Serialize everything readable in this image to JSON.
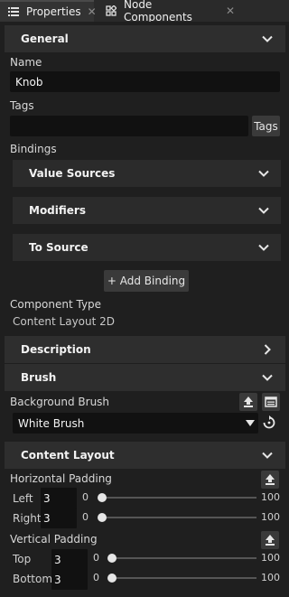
{
  "tabs": [
    {
      "label": "Properties",
      "icon": "list-icon",
      "close": "✕"
    },
    {
      "label": "Node Components",
      "icon": "node-components-icon",
      "close": "✕"
    }
  ],
  "general": {
    "title": "General",
    "name_label": "Name",
    "name_value": "Knob",
    "tags_label": "Tags",
    "tags_value": "",
    "tags_button": "Tags",
    "bindings_label": "Bindings",
    "bindings": [
      {
        "label": "Value Sources"
      },
      {
        "label": "Modifiers"
      },
      {
        "label": "To Source"
      }
    ],
    "add_binding": "+ Add Binding",
    "component_type_label": "Component Type",
    "component_type_value": "Content Layout 2D"
  },
  "description": {
    "title": "Description"
  },
  "brush": {
    "title": "Brush",
    "background_label": "Background Brush",
    "background_value": "White Brush"
  },
  "content_layout": {
    "title": "Content Layout",
    "horizontal_padding_label": "Horizontal Padding",
    "vertical_padding_label": "Vertical Padding",
    "rows": [
      {
        "label": "Left",
        "value": "3",
        "min": "0",
        "max": "100",
        "level": 0.0
      },
      {
        "label": "Right",
        "value": "3",
        "min": "0",
        "max": "100",
        "level": 0.0
      },
      {
        "label": "Top",
        "value": "3",
        "min": "0",
        "max": "100",
        "level": 0.0
      },
      {
        "label": "Bottom",
        "value": "3",
        "min": "0",
        "max": "100",
        "level": 0.0
      }
    ]
  },
  "colors": {
    "background": "#1f1f1f",
    "section": "#2e2e2e",
    "field": "#111111",
    "text": "#dcdcdc"
  }
}
